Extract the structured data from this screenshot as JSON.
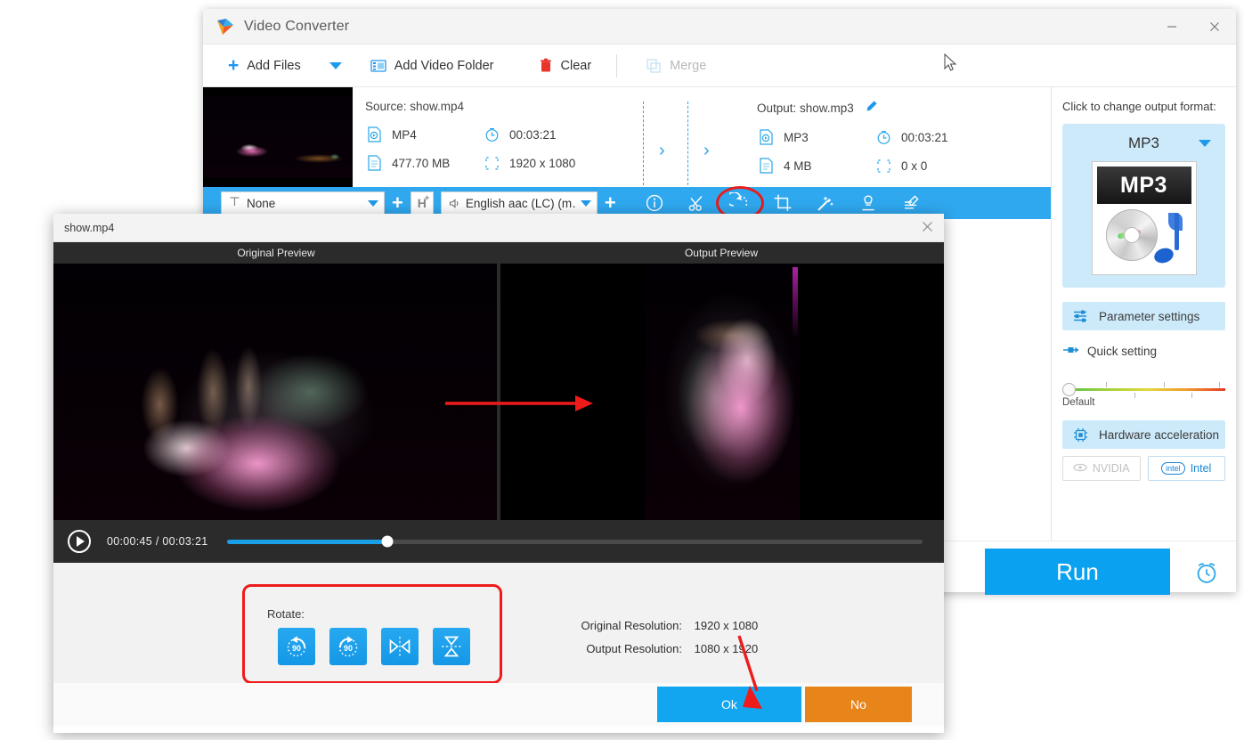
{
  "window": {
    "title": "Video Converter",
    "minimize_label": "—",
    "close_label": "✕"
  },
  "toolbar": {
    "add_files": "Add Files",
    "add_video_folder": "Add Video Folder",
    "clear": "Clear",
    "merge": "Merge"
  },
  "file_item": {
    "source_label": "Source: show.mp4",
    "output_label": "Output: show.mp3",
    "source": {
      "format": "MP4",
      "duration": "00:03:21",
      "size": "477.70 MB",
      "resolution": "1920 x 1080"
    },
    "output": {
      "format": "MP3",
      "duration": "00:03:21",
      "size": "4 MB",
      "resolution": "0 x 0"
    }
  },
  "edit_bar": {
    "subtitle_value": "None",
    "audio_value": "English aac (LC) (m…",
    "hdr_label": "H",
    "add_subtitle_label": "+",
    "add_audio_label": "+",
    "icons": [
      {
        "name": "info-icon",
        "label": "Information"
      },
      {
        "name": "scissors-icon",
        "label": "Cut"
      },
      {
        "name": "rotate-icon",
        "label": "Rotate"
      },
      {
        "name": "crop-icon",
        "label": "Crop"
      },
      {
        "name": "effect-icon",
        "label": "Effect"
      },
      {
        "name": "watermark-icon",
        "label": "Watermark"
      },
      {
        "name": "subtitle-edit-icon",
        "label": "Subtitle Edit"
      }
    ]
  },
  "right_panel": {
    "change_format_label": "Click to change output format:",
    "format_name": "MP3",
    "format_badge": "MP3",
    "parameter_settings": "Parameter settings",
    "quick_setting": "Quick setting",
    "slider_default": "Default",
    "hardware_acceleration": "Hardware acceleration",
    "gpu_nvidia": "NVIDIA",
    "gpu_intel": "Intel",
    "gpu_intel_badge": "intel",
    "run_label": "Run"
  },
  "modal": {
    "title": "show.mp4",
    "close_label": "✕",
    "original_preview": "Original Preview",
    "output_preview": "Output Preview",
    "player": {
      "current_time": "00:00:45",
      "separator": "/",
      "total_time": "00:03:21",
      "progress_percent": 23
    },
    "rotate_label": "Rotate:",
    "rotate_buttons": [
      {
        "name": "rotate-left-90-button",
        "glyph": "90"
      },
      {
        "name": "rotate-right-90-button",
        "glyph": "90"
      },
      {
        "name": "flip-horizontal-button",
        "glyph": "▷◁"
      },
      {
        "name": "flip-vertical-button",
        "glyph": "▽△"
      }
    ],
    "original_resolution_label": "Original Resolution:",
    "original_resolution_value": "1920 x 1080",
    "output_resolution_label": "Output Resolution:",
    "output_resolution_value": "1080 x 1920",
    "ok_label": "Ok",
    "no_label": "No"
  },
  "colors": {
    "accent_blue": "#0aa2f0",
    "edit_bar_blue": "#2fa8ef",
    "annotation_red": "#ee1b1b",
    "orange": "#e8851a",
    "panel_light_blue": "#cdeafb"
  }
}
